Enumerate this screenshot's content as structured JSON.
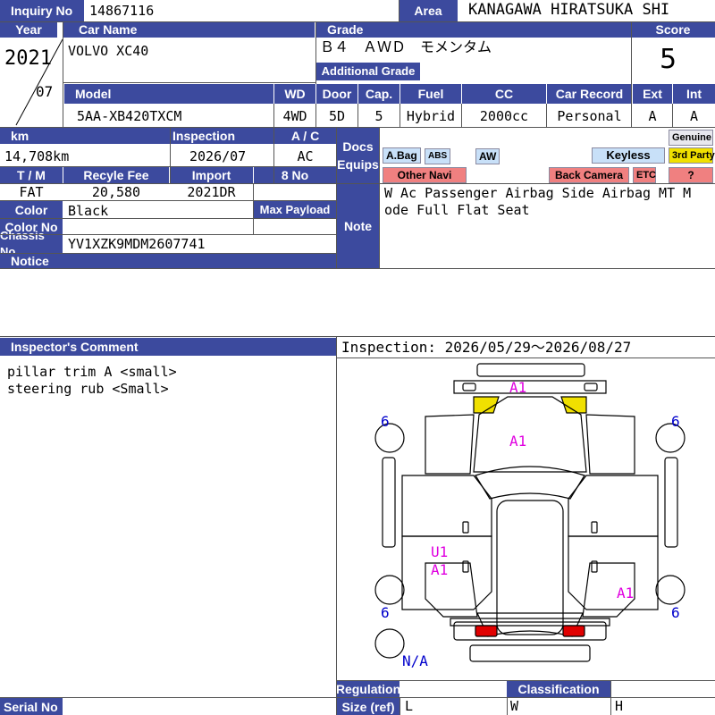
{
  "labels": {
    "inquiry_no": "Inquiry No",
    "area": "Area",
    "year": "Year",
    "car_name": "Car Name",
    "grade": "Grade",
    "score": "Score",
    "additional_grade": "Additional Grade",
    "model": "Model",
    "wd": "WD",
    "door": "Door",
    "cap": "Cap.",
    "fuel": "Fuel",
    "cc": "CC",
    "car_record": "Car Record",
    "ext": "Ext",
    "int": "Int",
    "km": "km",
    "inspection": "Inspection",
    "ac": "A / C",
    "docs": "Docs",
    "equips": "Equips",
    "genuine": "Genuine",
    "tm": "T / M",
    "recycle_fee": "Recyle Fee",
    "import": "Import",
    "eight_no": "8 No",
    "color": "Color",
    "max_payload": "Max Payload",
    "color_no": "Color No",
    "note": "Note",
    "chassis_no": "Chassis No",
    "notice": "Notice",
    "inspector_comment": "Inspector's Comment",
    "regulation": "Regulation",
    "classification": "Classification",
    "size_ref": "Size (ref)",
    "serial_no": "Serial No",
    "size_l": "L",
    "size_w": "W",
    "size_h": "H"
  },
  "values": {
    "inquiry_no": "14867116",
    "area": "KANAGAWA HIRATSUKA SHI",
    "year": "2021",
    "month": "07",
    "car_name": "VOLVO XC40",
    "grade": "Ｂ４　ＡＷＤ　モメンタム",
    "score": "5",
    "model": "5AA-XB420TXCM",
    "wd": "4WD",
    "door": "5D",
    "cap": "5",
    "fuel": "Hybrid",
    "cc": "2000cc",
    "car_record": "Personal",
    "ext": "A",
    "int": "A",
    "km": "14,708km",
    "inspection": "2026/07",
    "ac": "AC",
    "tm": "FAT",
    "recycle_fee": "20,580",
    "import": "2021DR",
    "color": "Black",
    "chassis_no": "YV1XZK9MDM2607741",
    "note_line1": "W Ac Passenger Airbag Side Airbag MT M",
    "note_line2": "ode Full Flat Seat",
    "comment_line1": "pillar trim A <small>",
    "comment_line2": "steering rub <Small>",
    "inspection_period": "Inspection: 2026/05/29〜2026/08/27"
  },
  "equips": {
    "abag": "A.Bag",
    "abs": "ABS",
    "aw": "AW",
    "keyless": "Keyless",
    "third_party": "3rd Party",
    "other_navi": "Other Navi",
    "back_camera": "Back Camera",
    "etc": "ETC",
    "unknown": "?"
  },
  "diagram": {
    "marks": {
      "front_a1": "A1",
      "hood_a1": "A1",
      "door_u1": "U1",
      "door_a1": "A1",
      "rear_a1": "A1",
      "tire_fl": "6",
      "tire_fr": "6",
      "tire_rl": "6",
      "tire_rr": "6",
      "spare": "N/A"
    },
    "colors": {
      "header": "#3c4a9e",
      "defect_mark": "#e000e0",
      "tire_mark": "#0000cc",
      "damage_yellow": "#f0e000",
      "tail_red": "#e00000"
    }
  }
}
